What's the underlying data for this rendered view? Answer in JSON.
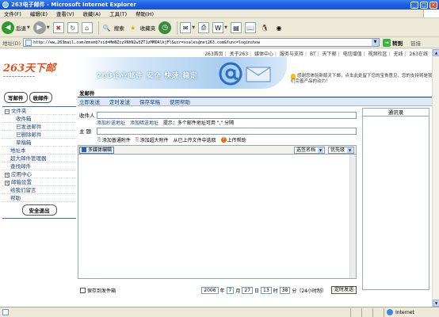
{
  "window": {
    "title": "263电子邮件 - Microsoft Internet Explorer"
  },
  "menu": [
    "文件(F)",
    "编辑(E)",
    "查看(V)",
    "收藏(A)",
    "工具(T)",
    "帮助(H)"
  ],
  "toolbar": {
    "back": "后退",
    "search": "搜索",
    "favorites": "收藏夹"
  },
  "address": {
    "label": "地址(D)",
    "url": "http://ww.263mail.com/mmsmb?sid=MmNZczXNhN2w3ZT1zMMOAlkjFl&usr=xsales@net263.com&func=loginshow",
    "go": "转到",
    "links": "链接"
  },
  "top_links": [
    "263首页",
    "关于263",
    "媒体中心",
    "服务与支持",
    "BT",
    "天下邮",
    "电信增值",
    "视频社区",
    "无线",
    "263在线"
  ],
  "banner": {
    "logo": "263天下邮",
    "slogan": "263企业邮件 安全 快速 稳定",
    "notice": "感谢您体验新版天下邮，点击此处留下您的宝贵意见，您的支持将是我们完善产品的动力！"
  },
  "sidebar": {
    "write_button": "写邮件",
    "receive_button": "收邮件",
    "folders_label": "文件夹",
    "folders": [
      "收件箱",
      "已发送邮件",
      "已删除邮件",
      "草稿箱"
    ],
    "address_book": "地址本",
    "super_manager": "超大邮件管理器",
    "search_mail": "查找邮件",
    "app_center": "应用中心",
    "mail_settings": "邮箱设置",
    "feedback": "给我们留言",
    "help": "帮助",
    "logout": "安全退出"
  },
  "compose": {
    "title": "发邮件",
    "tabs": [
      "立即发送",
      "定时发送",
      "保存草稿",
      "使用帮助"
    ],
    "to_label": "收件人",
    "add_cc": "添加抄送地址",
    "add_bcc": "添加暗送地址",
    "hint": "提示：多个邮件地址可用 \",\" 分隔",
    "subject_label": "主  题",
    "attach_normal": "添加普通附件",
    "attach_super": "添加超大附件",
    "attach_from_uploaded": "从已上传文件中选取",
    "upload_help": "上传帮助",
    "rich_text": "多媒体编辑",
    "signature": "选签名档",
    "priority": "优先级",
    "save_to_sent": "保存到发件箱",
    "year": "2006",
    "year_unit": "年",
    "month": "7",
    "month_unit": "月",
    "day": "27",
    "day_unit": "日",
    "hour": "13",
    "hour_unit": "时",
    "minute": "38",
    "minute_unit": "分（24小时制）",
    "timed_send": "定时发送"
  },
  "address_book_panel": {
    "title": "通讯录"
  },
  "status": {
    "text": "",
    "zone": "Internet"
  },
  "colors": {
    "titlebar": "#1c5fe0",
    "accent": "#1a3c7a",
    "logo_orange": "#e05020"
  }
}
